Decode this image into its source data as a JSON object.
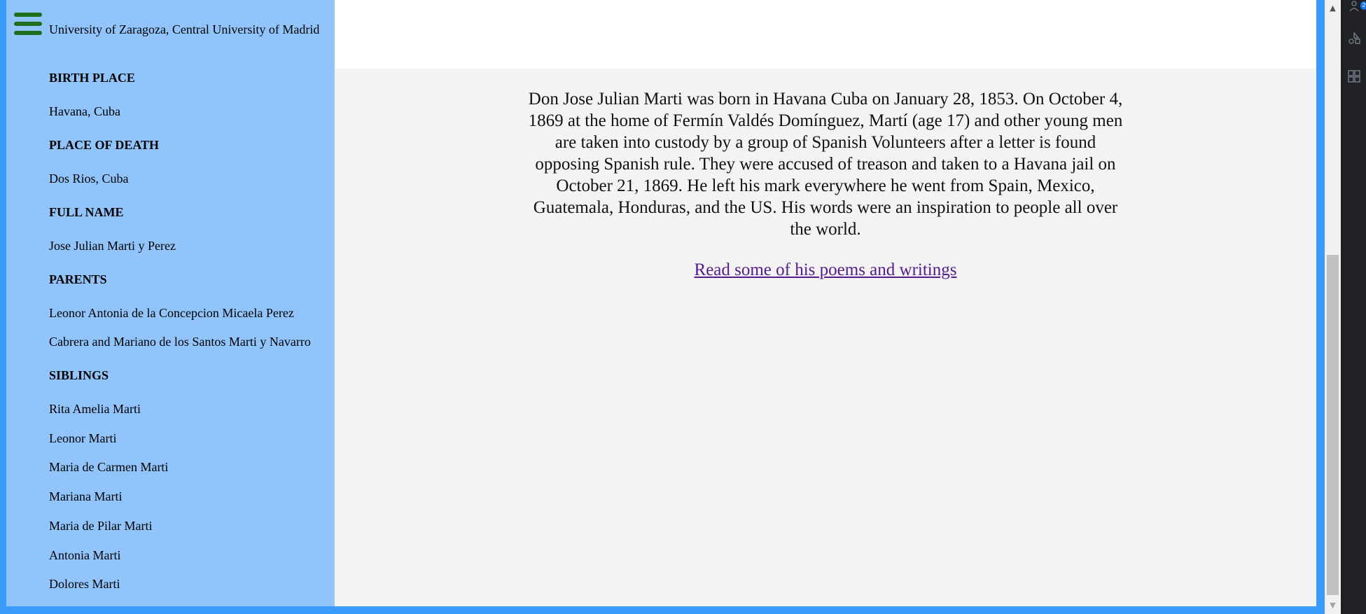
{
  "sidebar": {
    "education_value": "University of Zaragoza, Central University of Madrid",
    "birth_place_heading": "BIRTH PLACE",
    "birth_place_value": "Havana, Cuba",
    "place_of_death_heading": "PLACE OF DEATH",
    "place_of_death_value": "Dos Rios, Cuba",
    "full_name_heading": "FULL NAME",
    "full_name_value": "Jose Julian Marti y Perez",
    "parents_heading": "PARENTS",
    "parents_line1": "Leonor Antonia de la Concepcion Micaela Perez",
    "parents_line2": "Cabrera and Mariano de los Santos Marti y Navarro",
    "siblings_heading": "SIBLINGS",
    "siblings": [
      "Rita Amelia Marti",
      "Leonor Marti",
      "Maria de Carmen Marti",
      "Mariana Marti",
      "Maria de Pilar Marti",
      "Antonia Marti",
      "Dolores Marti"
    ]
  },
  "main": {
    "bio": "Don Jose Julian Marti was born in Havana Cuba on January 28, 1853. On October 4, 1869 at the home of Fermín Valdés Domínguez, Martí (age 17) and other young men are taken into custody by a group of Spanish Volunteers after a letter is found opposing Spanish rule. They were accused of treason and taken to a Havana jail on October 21, 1869. He left his mark everywhere he went from Spain, Mexico, Guatemala, Honduras, and the US. His words were an inspiration to people all over the world.",
    "poems_link": "Read some of his poems and writings"
  },
  "scrollbar": {
    "up_glyph": "▲",
    "down_glyph": "▼"
  },
  "side_panel": {
    "badge": "2",
    "icons": [
      "people-icon",
      "shapes-icon",
      "apps-icon"
    ]
  },
  "colors": {
    "sidebar_bg": "#90c4fa",
    "frame": "#3a9bfd",
    "menu_icon": "#1d6e1d",
    "link": "#551a8b",
    "main_bg": "#f3f3f3"
  }
}
